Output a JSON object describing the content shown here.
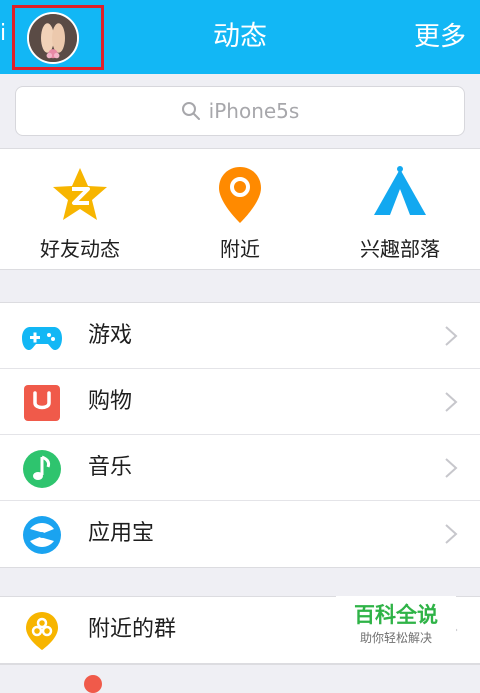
{
  "header": {
    "title": "动态",
    "more_label": "更多",
    "edge_glyph": "ⅰ",
    "colors": {
      "bar": "#12b7f5",
      "highlight": "#e0202a"
    }
  },
  "search": {
    "placeholder": "iPhone5s",
    "icon": "search-icon"
  },
  "quick_entries": [
    {
      "label": "好友动态",
      "icon": "qzone-star-icon",
      "color": "#f7b500"
    },
    {
      "label": "附近",
      "icon": "location-pin-icon",
      "color": "#ff8a00"
    },
    {
      "label": "兴趣部落",
      "icon": "tent-icon",
      "color": "#12a8f0"
    }
  ],
  "section1": [
    {
      "label": "游戏",
      "icon": "gamepad-icon",
      "color": "#12b7f5"
    },
    {
      "label": "购物",
      "icon": "shopping-bag-icon",
      "color": "#f05a4a"
    },
    {
      "label": "音乐",
      "icon": "music-note-icon",
      "color": "#2ec46e"
    },
    {
      "label": "应用宝",
      "icon": "app-store-icon",
      "color": "#1aa3f0"
    }
  ],
  "section2": [
    {
      "label": "附近的群",
      "icon": "nearby-group-icon",
      "color": "#f7b500"
    }
  ],
  "watermark": {
    "title": "百科全说",
    "subtitle": "助你轻松解决"
  }
}
